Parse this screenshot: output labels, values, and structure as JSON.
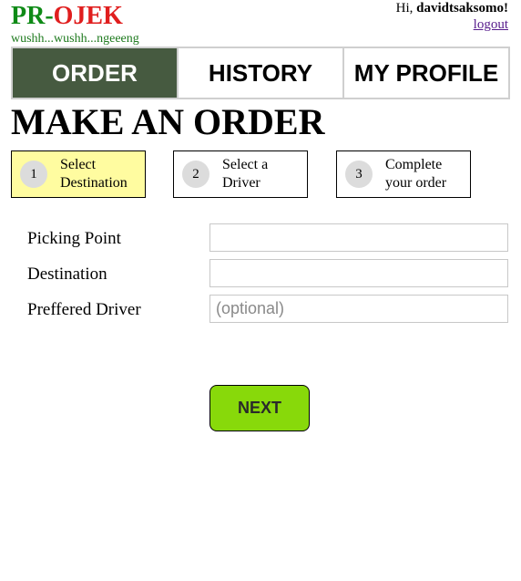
{
  "header": {
    "logo_left": "PR",
    "logo_dash": "-",
    "logo_right": "OJEK",
    "tagline": "wushh...wushh...ngeeeng",
    "greeting_prefix": "Hi, ",
    "username": "davidtsaksomo!",
    "logout_label": "logout"
  },
  "nav": {
    "tabs": [
      {
        "label": "ORDER",
        "active": true
      },
      {
        "label": "HISTORY",
        "active": false
      },
      {
        "label": "MY PROFILE",
        "active": false
      }
    ]
  },
  "main": {
    "title": "MAKE AN ORDER",
    "steps": [
      {
        "number": "1",
        "label": "Select Destination",
        "active": true
      },
      {
        "number": "2",
        "label": "Select a Driver",
        "active": false
      },
      {
        "number": "3",
        "label": "Complete your order",
        "active": false
      }
    ],
    "form": {
      "picking_point": {
        "label": "Picking Point",
        "value": "",
        "placeholder": ""
      },
      "destination": {
        "label": "Destination",
        "value": "",
        "placeholder": ""
      },
      "preferred_driver": {
        "label": "Preffered Driver",
        "value": "",
        "placeholder": "(optional)"
      }
    },
    "next_label": "NEXT"
  },
  "colors": {
    "logo_green": "#0e8a16",
    "logo_red": "#e01e1e",
    "nav_active_bg": "#465a40",
    "step_active_bg": "#fffca0",
    "next_button_bg": "#88d90a"
  }
}
